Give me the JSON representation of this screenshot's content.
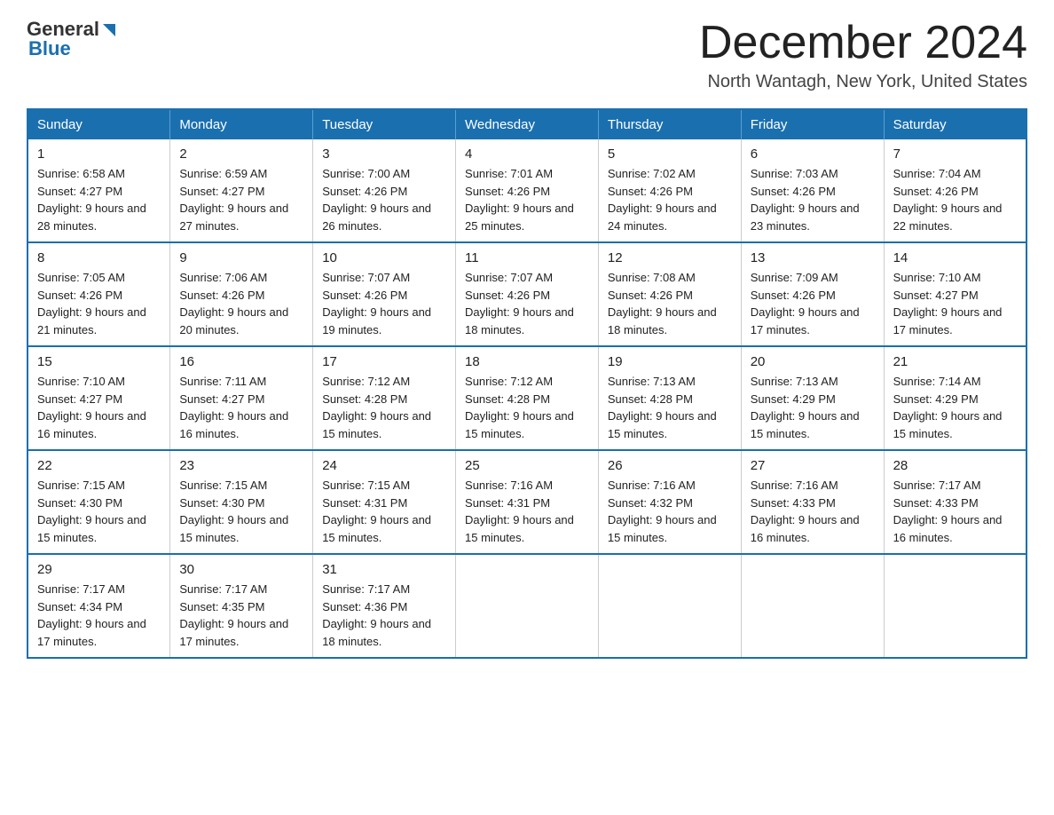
{
  "header": {
    "logo_general": "General",
    "logo_blue": "Blue",
    "month_title": "December 2024",
    "location": "North Wantagh, New York, United States"
  },
  "days_of_week": [
    "Sunday",
    "Monday",
    "Tuesday",
    "Wednesday",
    "Thursday",
    "Friday",
    "Saturday"
  ],
  "weeks": [
    [
      {
        "day": "1",
        "sunrise": "6:58 AM",
        "sunset": "4:27 PM",
        "daylight": "9 hours and 28 minutes."
      },
      {
        "day": "2",
        "sunrise": "6:59 AM",
        "sunset": "4:27 PM",
        "daylight": "9 hours and 27 minutes."
      },
      {
        "day": "3",
        "sunrise": "7:00 AM",
        "sunset": "4:26 PM",
        "daylight": "9 hours and 26 minutes."
      },
      {
        "day": "4",
        "sunrise": "7:01 AM",
        "sunset": "4:26 PM",
        "daylight": "9 hours and 25 minutes."
      },
      {
        "day": "5",
        "sunrise": "7:02 AM",
        "sunset": "4:26 PM",
        "daylight": "9 hours and 24 minutes."
      },
      {
        "day": "6",
        "sunrise": "7:03 AM",
        "sunset": "4:26 PM",
        "daylight": "9 hours and 23 minutes."
      },
      {
        "day": "7",
        "sunrise": "7:04 AM",
        "sunset": "4:26 PM",
        "daylight": "9 hours and 22 minutes."
      }
    ],
    [
      {
        "day": "8",
        "sunrise": "7:05 AM",
        "sunset": "4:26 PM",
        "daylight": "9 hours and 21 minutes."
      },
      {
        "day": "9",
        "sunrise": "7:06 AM",
        "sunset": "4:26 PM",
        "daylight": "9 hours and 20 minutes."
      },
      {
        "day": "10",
        "sunrise": "7:07 AM",
        "sunset": "4:26 PM",
        "daylight": "9 hours and 19 minutes."
      },
      {
        "day": "11",
        "sunrise": "7:07 AM",
        "sunset": "4:26 PM",
        "daylight": "9 hours and 18 minutes."
      },
      {
        "day": "12",
        "sunrise": "7:08 AM",
        "sunset": "4:26 PM",
        "daylight": "9 hours and 18 minutes."
      },
      {
        "day": "13",
        "sunrise": "7:09 AM",
        "sunset": "4:26 PM",
        "daylight": "9 hours and 17 minutes."
      },
      {
        "day": "14",
        "sunrise": "7:10 AM",
        "sunset": "4:27 PM",
        "daylight": "9 hours and 17 minutes."
      }
    ],
    [
      {
        "day": "15",
        "sunrise": "7:10 AM",
        "sunset": "4:27 PM",
        "daylight": "9 hours and 16 minutes."
      },
      {
        "day": "16",
        "sunrise": "7:11 AM",
        "sunset": "4:27 PM",
        "daylight": "9 hours and 16 minutes."
      },
      {
        "day": "17",
        "sunrise": "7:12 AM",
        "sunset": "4:28 PM",
        "daylight": "9 hours and 15 minutes."
      },
      {
        "day": "18",
        "sunrise": "7:12 AM",
        "sunset": "4:28 PM",
        "daylight": "9 hours and 15 minutes."
      },
      {
        "day": "19",
        "sunrise": "7:13 AM",
        "sunset": "4:28 PM",
        "daylight": "9 hours and 15 minutes."
      },
      {
        "day": "20",
        "sunrise": "7:13 AM",
        "sunset": "4:29 PM",
        "daylight": "9 hours and 15 minutes."
      },
      {
        "day": "21",
        "sunrise": "7:14 AM",
        "sunset": "4:29 PM",
        "daylight": "9 hours and 15 minutes."
      }
    ],
    [
      {
        "day": "22",
        "sunrise": "7:15 AM",
        "sunset": "4:30 PM",
        "daylight": "9 hours and 15 minutes."
      },
      {
        "day": "23",
        "sunrise": "7:15 AM",
        "sunset": "4:30 PM",
        "daylight": "9 hours and 15 minutes."
      },
      {
        "day": "24",
        "sunrise": "7:15 AM",
        "sunset": "4:31 PM",
        "daylight": "9 hours and 15 minutes."
      },
      {
        "day": "25",
        "sunrise": "7:16 AM",
        "sunset": "4:31 PM",
        "daylight": "9 hours and 15 minutes."
      },
      {
        "day": "26",
        "sunrise": "7:16 AM",
        "sunset": "4:32 PM",
        "daylight": "9 hours and 15 minutes."
      },
      {
        "day": "27",
        "sunrise": "7:16 AM",
        "sunset": "4:33 PM",
        "daylight": "9 hours and 16 minutes."
      },
      {
        "day": "28",
        "sunrise": "7:17 AM",
        "sunset": "4:33 PM",
        "daylight": "9 hours and 16 minutes."
      }
    ],
    [
      {
        "day": "29",
        "sunrise": "7:17 AM",
        "sunset": "4:34 PM",
        "daylight": "9 hours and 17 minutes."
      },
      {
        "day": "30",
        "sunrise": "7:17 AM",
        "sunset": "4:35 PM",
        "daylight": "9 hours and 17 minutes."
      },
      {
        "day": "31",
        "sunrise": "7:17 AM",
        "sunset": "4:36 PM",
        "daylight": "9 hours and 18 minutes."
      },
      null,
      null,
      null,
      null
    ]
  ]
}
